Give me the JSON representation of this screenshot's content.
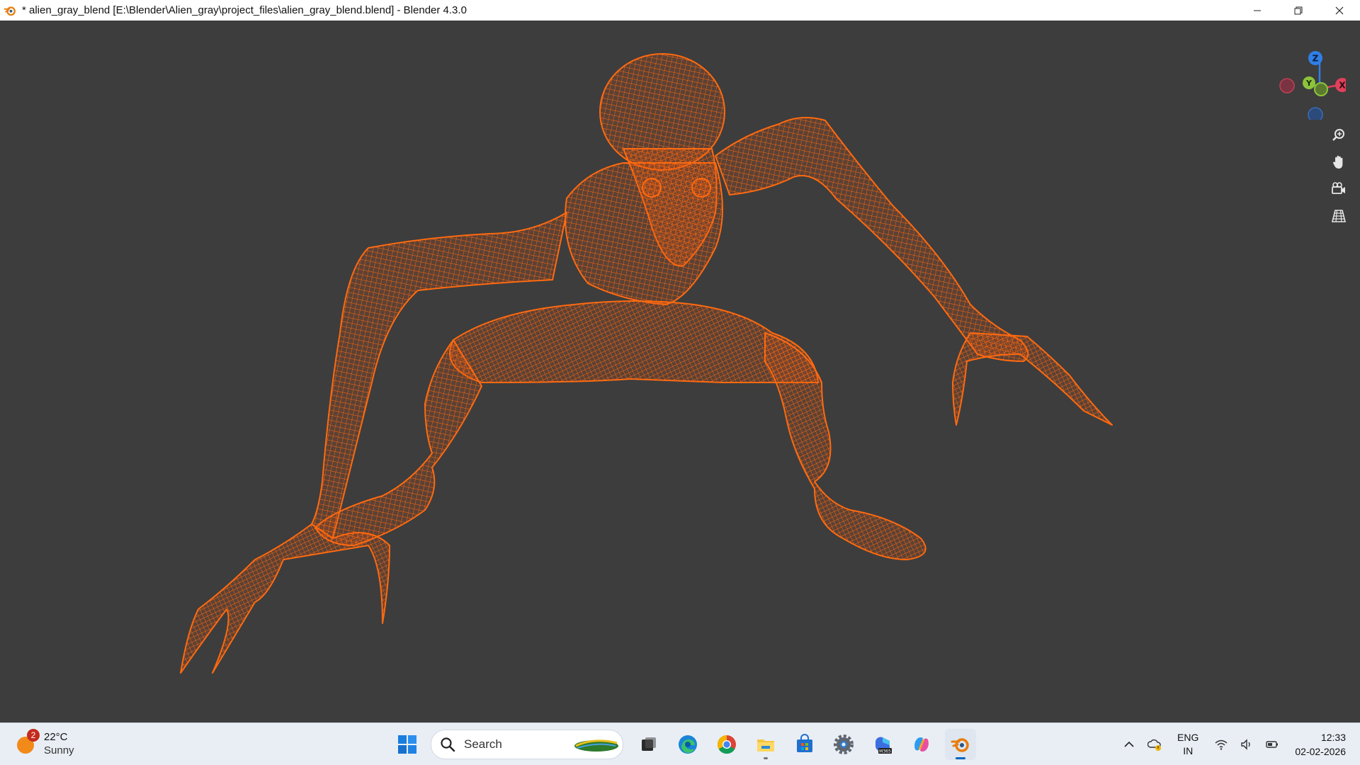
{
  "window": {
    "title": "* alien_gray_blend [E:\\Blender\\Alien_gray\\project_files\\alien_gray_blend.blend] - Blender 4.3.0"
  },
  "gizmo": {
    "axes": {
      "z": "Z",
      "y": "Y",
      "x": "X"
    },
    "colors": {
      "x": "#e0405a",
      "y": "#8cc43c",
      "z": "#2f7fe6"
    }
  },
  "nav_tools": [
    {
      "name": "zoom",
      "icon": "zoom-in-icon"
    },
    {
      "name": "pan",
      "icon": "hand-icon"
    },
    {
      "name": "camera",
      "icon": "camera-icon"
    },
    {
      "name": "perspective",
      "icon": "grid-icon"
    }
  ],
  "viewport": {
    "mesh_color": "#ff6a10",
    "background": "#3d3d3d"
  },
  "taskbar": {
    "weather": {
      "badge": "2",
      "temp": "22°C",
      "condition": "Sunny"
    },
    "search": {
      "placeholder": "Search"
    },
    "apps": [
      "start",
      "task-view",
      "edge",
      "chrome",
      "file-explorer",
      "store",
      "settings",
      "m365",
      "copilot",
      "blender"
    ],
    "m365_label": "M365",
    "tray": {
      "lang_top": "ENG",
      "lang_bottom": "IN",
      "time": "12:33",
      "date": "02-02-2026"
    }
  }
}
